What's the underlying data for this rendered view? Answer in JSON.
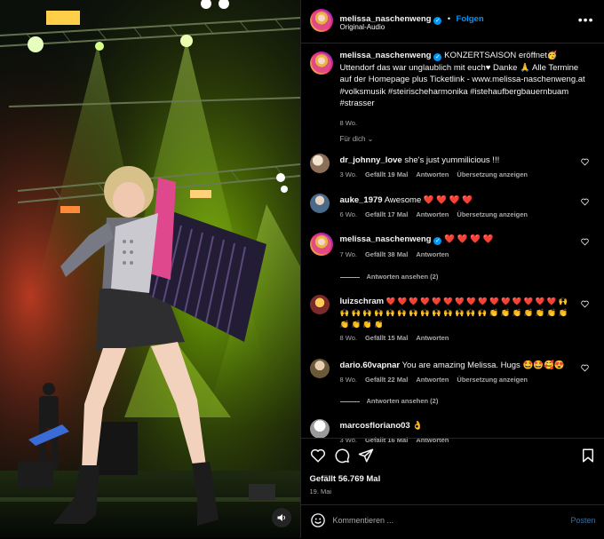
{
  "header": {
    "username": "melissa_naschenweng",
    "separator": "•",
    "follow_label": "Folgen",
    "audio": "Original-Audio",
    "more_icon": "more-horizontal-icon"
  },
  "caption": {
    "username": "melissa_naschenweng",
    "text": "KONZERTSAISON eröffnet🥳 Uttendorf das war unglaublich mit euch♥ Danke 🙏 Alle Termine auf der Homepage plus Ticketlink - www.melissa-naschenweng.at #volksmusik #steirischeharmonika #istehaufbergbauernbuam #strasser",
    "age": "8 Wo."
  },
  "for_you_label": "Für dich",
  "comments": [
    {
      "username": "dr_johnny_love",
      "text": "she's just yummilicious !!!",
      "age": "3 Wo.",
      "likes": "Gefällt 19 Mal",
      "reply": "Antworten",
      "translate": "Übersetzung anzeigen"
    },
    {
      "username": "auke_1979",
      "text": "Awesome ❤️ ❤️ ❤️ ❤️",
      "age": "6 Wo.",
      "likes": "Gefällt 17 Mal",
      "reply": "Antworten",
      "translate": "Übersetzung anzeigen"
    },
    {
      "username": "melissa_naschenweng",
      "text": "❤️ ❤️ ❤️ ❤️",
      "age": "7 Wo.",
      "likes": "Gefällt 38 Mal",
      "reply": "Antworten",
      "view_replies": "Antworten ansehen (2)"
    },
    {
      "username": "luizschram",
      "text": "❤️ ❤️ ❤️ ❤️ ❤️ ❤️ ❤️ ❤️ ❤️ ❤️ ❤️ ❤️ ❤️ ❤️ ❤️ 🙌 🙌 🙌 🙌 🙌 🙌 🙌 🙌 🙌 🙌 🙌 🙌 🙌 🙌 👏 👏 👏 👏 👏 👏 👏 👏 👏 👏 👏",
      "age": "8 Wo.",
      "likes": "Gefällt 15 Mal",
      "reply": "Antworten"
    },
    {
      "username": "dario.60vapnar",
      "text": "You are amazing Melissa. Hugs 🤩🤩🥰😍",
      "age": "8 Wo.",
      "likes": "Gefällt 22 Mal",
      "reply": "Antworten",
      "translate": "Übersetzung anzeigen",
      "view_replies": "Antworten ansehen (2)"
    },
    {
      "username": "marcosfloriano03",
      "text": "👌",
      "age": "3 Wo.",
      "likes": "Gefällt 16 Mal",
      "reply": "Antworten"
    }
  ],
  "actions": {
    "like_icon": "heart-outline-icon",
    "comment_icon": "comment-icon",
    "share_icon": "paper-plane-icon",
    "save_icon": "bookmark-icon"
  },
  "likes_total": "Gefällt 56.769 Mal",
  "post_date": "19. Mai",
  "composer": {
    "placeholder": "Kommentieren ...",
    "post_label": "Posten"
  },
  "colors": {
    "accent": "#0095f6",
    "background": "#000000",
    "secondary_text": "#a8a8a8"
  }
}
